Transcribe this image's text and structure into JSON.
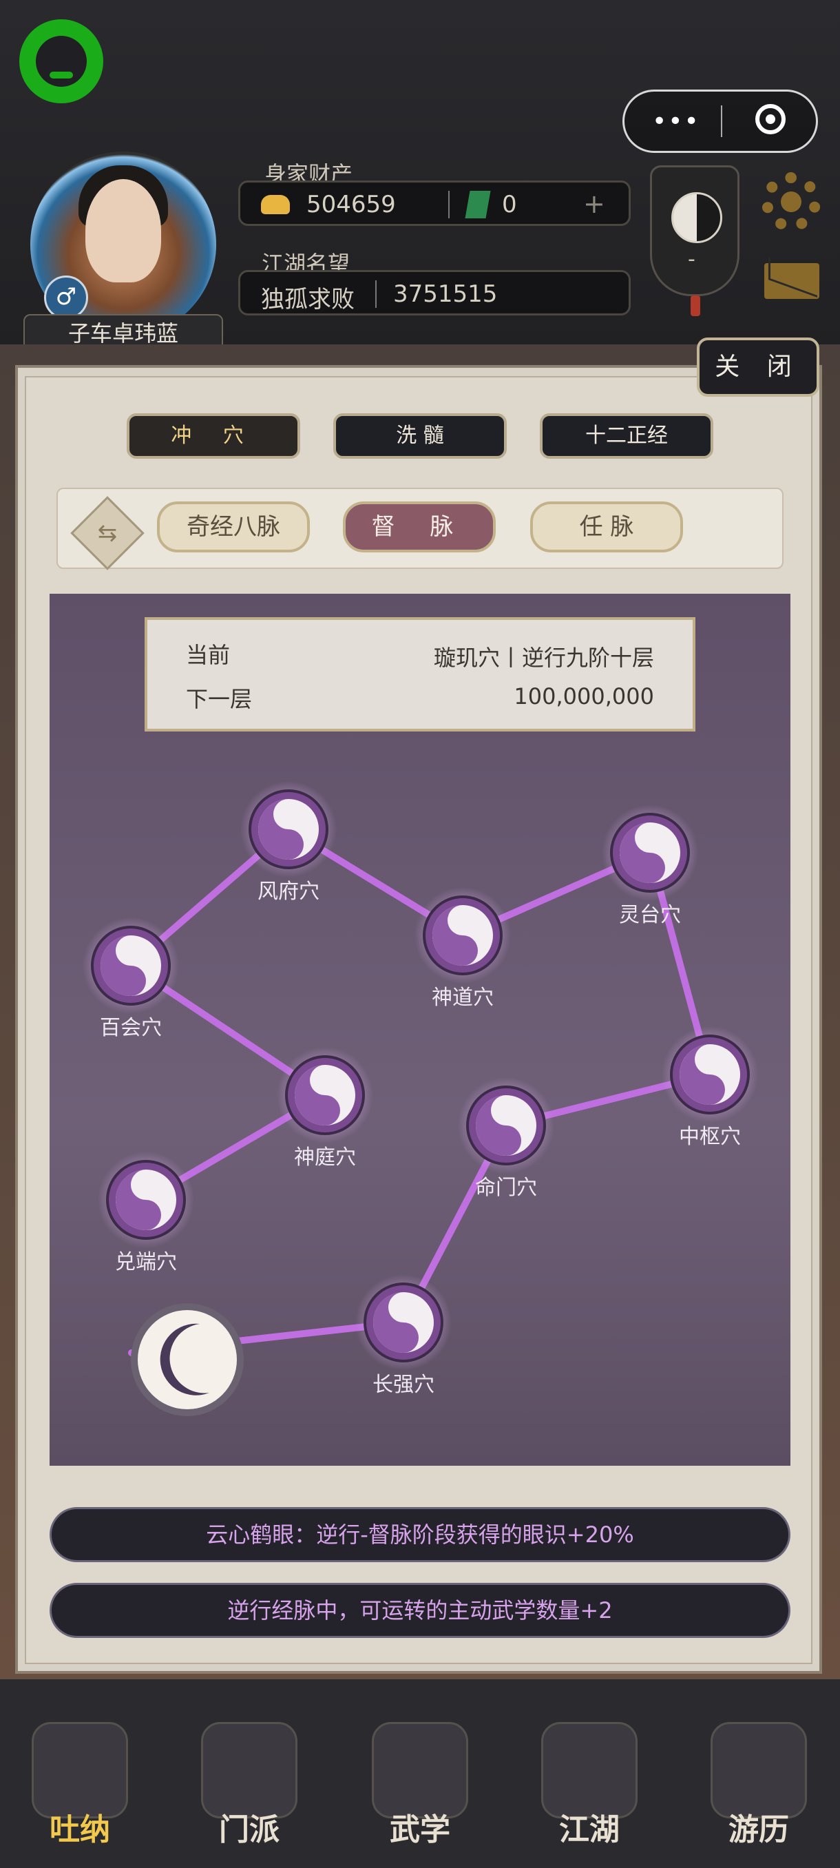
{
  "player": {
    "name": "子车卓玮蓝",
    "gender_symbol": "♂"
  },
  "wealth": {
    "label": "身家财产",
    "gold": "504659",
    "jade": "0",
    "add": "+"
  },
  "fame": {
    "label": "江湖名望",
    "title": "独孤求败",
    "value": "3751515"
  },
  "emblem": {
    "text": "-"
  },
  "modal": {
    "close_label": "关 闭"
  },
  "top_tabs": [
    "冲 穴",
    "洗 髓",
    "十二正经"
  ],
  "sub_tabs": [
    "奇经八脉",
    "督 脉",
    "任 脉"
  ],
  "swap_icon": "⇆",
  "info": {
    "current_label": "当前",
    "current_value": "璇玑穴丨逆行九阶十层",
    "next_label": "下一层",
    "next_value": "100,000,000"
  },
  "acupoints": [
    "风府穴",
    "灵台穴",
    "神道穴",
    "百会穴",
    "中枢穴",
    "神庭穴",
    "命门穴",
    "兑端穴",
    "长强穴"
  ],
  "buffs": [
    "云心鹤眼：逆行-督脉阶段获得的眼识+20%",
    "逆行经脉中，可运转的主动武学数量+2"
  ],
  "nav": [
    "吐纳",
    "门派",
    "武学",
    "江湖",
    "游历"
  ],
  "colors": {
    "accent_purple": "#c06fe0",
    "gold": "#f3d58a",
    "buff_text": "#d7a3ea"
  }
}
